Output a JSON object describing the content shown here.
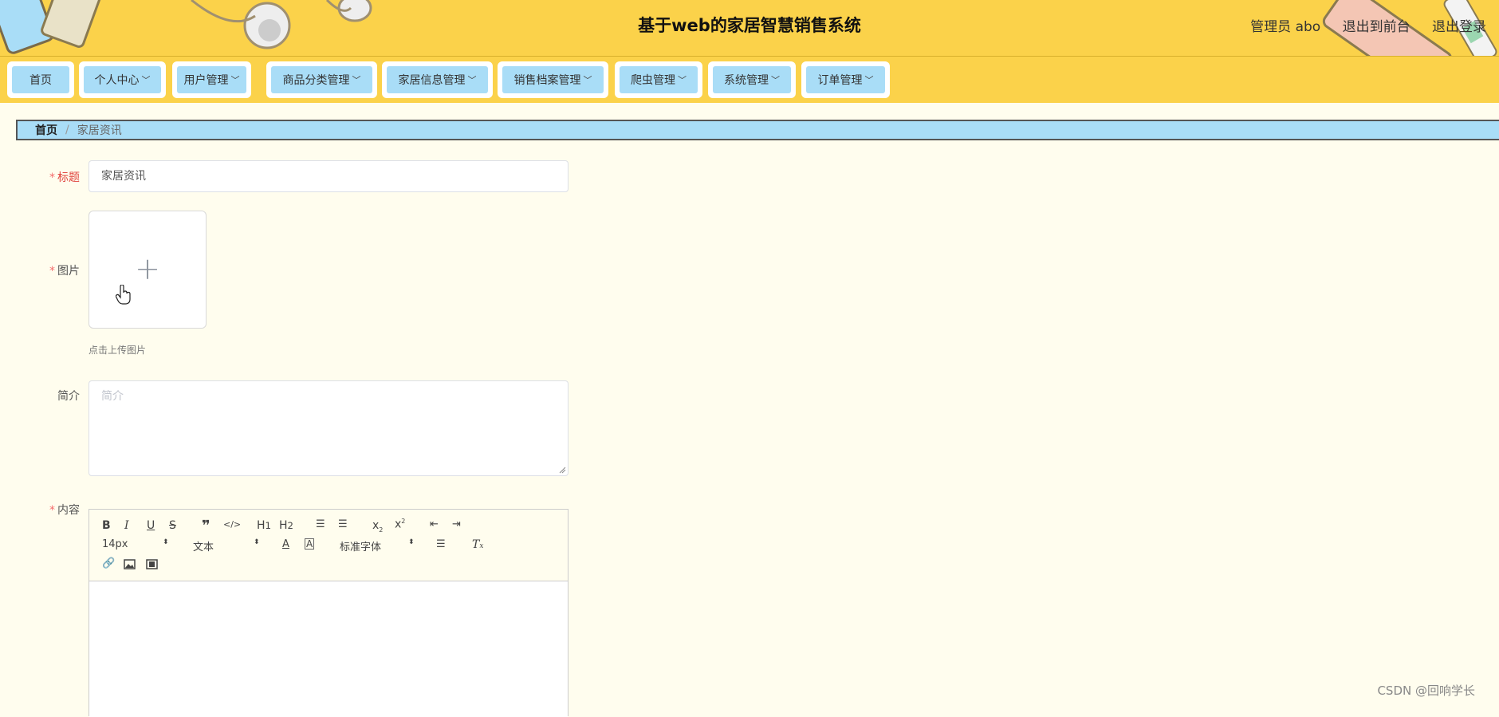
{
  "header": {
    "title": "基于web的家居智慧销售系统",
    "user_label": "管理员 abo",
    "front_link": "退出到前台",
    "logout_link": "退出登录"
  },
  "nav": {
    "items": [
      {
        "label": "首页",
        "has_arrow": false
      },
      {
        "label": "个人中心",
        "has_arrow": true
      },
      {
        "label": "用户管理",
        "has_arrow": true
      },
      {
        "label": "商品分类管理",
        "has_arrow": true
      },
      {
        "label": "家居信息管理",
        "has_arrow": true
      },
      {
        "label": "销售档案管理",
        "has_arrow": true
      },
      {
        "label": "爬虫管理",
        "has_arrow": true
      },
      {
        "label": "系统管理",
        "has_arrow": true
      },
      {
        "label": "订单管理",
        "has_arrow": true
      }
    ]
  },
  "breadcrumb": {
    "home": "首页",
    "separator": "/",
    "current": "家居资讯"
  },
  "form": {
    "title_label": "标题",
    "title_value": "家居资讯",
    "image_label": "图片",
    "upload_tip": "点击上传图片",
    "intro_label": "简介",
    "intro_placeholder": "简介",
    "content_label": "内容",
    "required_mark": "*"
  },
  "editor": {
    "font_size": "14px",
    "header_select": "文本",
    "font_family": "标准字体",
    "icons": [
      "bold-icon",
      "italic-icon",
      "underline-icon",
      "strike-icon",
      "quote-icon",
      "code-icon",
      "h1-icon",
      "h2-icon",
      "ordered-list-icon",
      "bullet-list-icon",
      "subscript-icon",
      "superscript-icon",
      "outdent-icon",
      "indent-icon",
      "font-color-icon",
      "background-color-icon",
      "align-icon",
      "clean-format-icon",
      "link-icon",
      "image-icon",
      "video-icon"
    ]
  },
  "watermark": "CSDN @回响学长",
  "colors": {
    "header_bg": "#fbd24a",
    "nav_item_bg": "#a9ddf7",
    "page_bg": "#fffdee",
    "required": "#f56c6c"
  }
}
